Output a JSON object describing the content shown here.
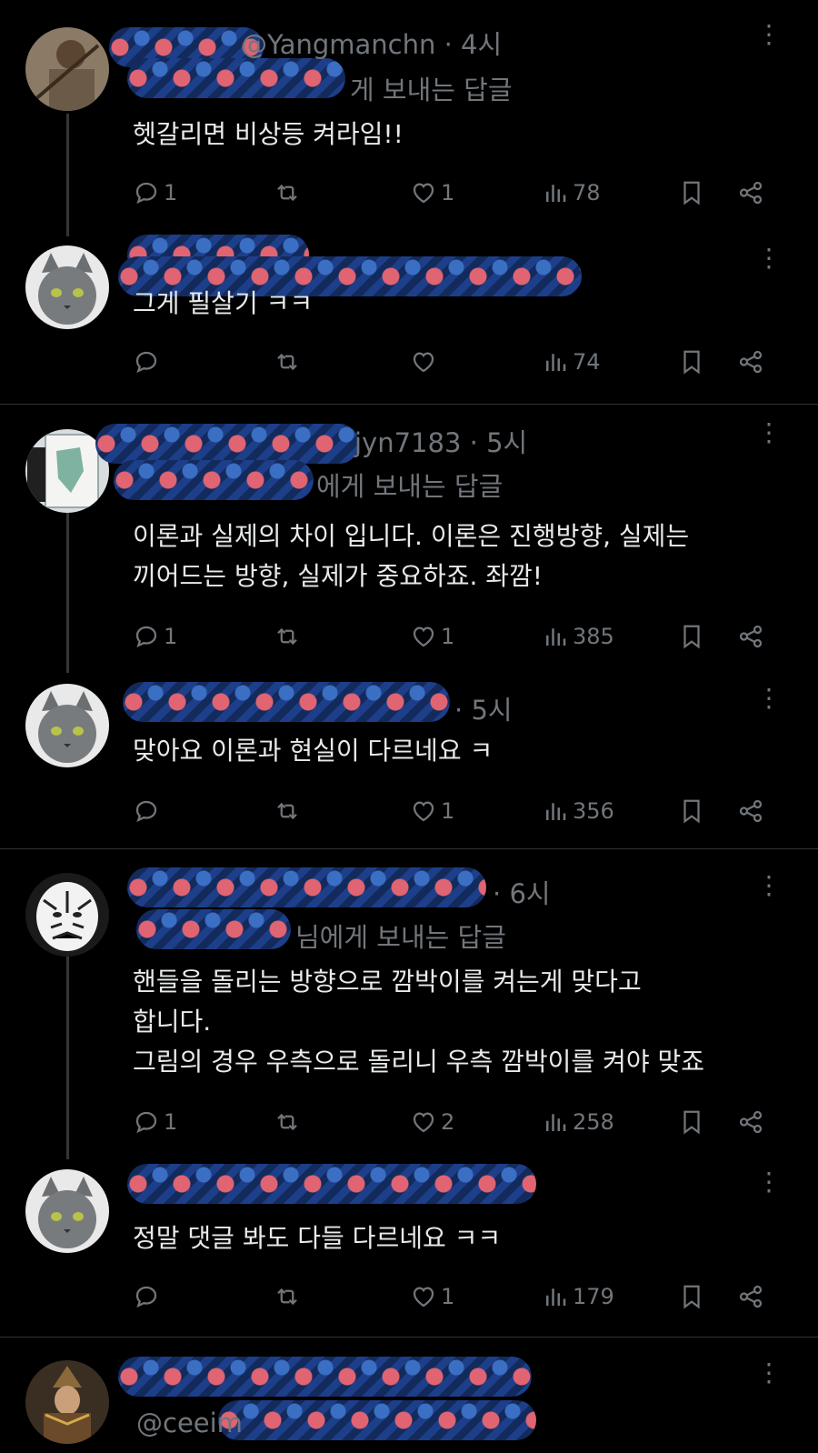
{
  "tweets": [
    {
      "handle_visible": "@Yangmanchn",
      "time": "4시",
      "reply_to": "게 보내는 답글",
      "text": "헷갈리면 비상등 켜라임!!",
      "replies": "1",
      "retweets": "",
      "likes": "1",
      "views": "78"
    },
    {
      "handle_visible": "",
      "time": "",
      "reply_to": "",
      "text": "그게 필살기 ㅋㅋ",
      "replies": "",
      "retweets": "",
      "likes": "",
      "views": "74"
    },
    {
      "handle_visible": "jyn7183",
      "time": "5시",
      "reply_to": "에게 보내는 답글",
      "text": "이론과 실제의 차이 입니다. 이론은 진행방향, 실제는\n끼어드는 방향, 실제가 중요하죠. 좌깜!",
      "replies": "1",
      "retweets": "",
      "likes": "1",
      "views": "385"
    },
    {
      "handle_visible": "",
      "time": "5시",
      "reply_to": "",
      "text": "맞아요 이론과 현실이 다르네요 ㅋ",
      "replies": "",
      "retweets": "",
      "likes": "1",
      "views": "356"
    },
    {
      "handle_visible": "",
      "time": "6시",
      "reply_to": "님에게 보내는 답글",
      "text": "핸들을 돌리는 방향으로 깜박이를 켜는게 맞다고\n합니다.\n그림의 경우 우측으로 돌리니 우측 깜박이를 켜야 맞죠",
      "replies": "1",
      "retweets": "",
      "likes": "2",
      "views": "258"
    },
    {
      "handle_visible": "",
      "time": "",
      "reply_to": "",
      "text": "정말 댓글 봐도 다들 다르네요 ㅋㅋ",
      "replies": "",
      "retweets": "",
      "likes": "1",
      "views": "179"
    },
    {
      "handle_visible": "@ceeim",
      "time": "",
      "reply_to": "",
      "text": "",
      "replies": "",
      "retweets": "",
      "likes": "",
      "views": ""
    }
  ],
  "colors": {
    "background": "#000000",
    "text": "#e7e9ea",
    "muted": "#71767b",
    "divider": "#2f3336"
  },
  "icons": [
    "reply-icon",
    "retweet-icon",
    "like-icon",
    "views-icon",
    "bookmark-icon",
    "share-icon",
    "more-icon"
  ]
}
